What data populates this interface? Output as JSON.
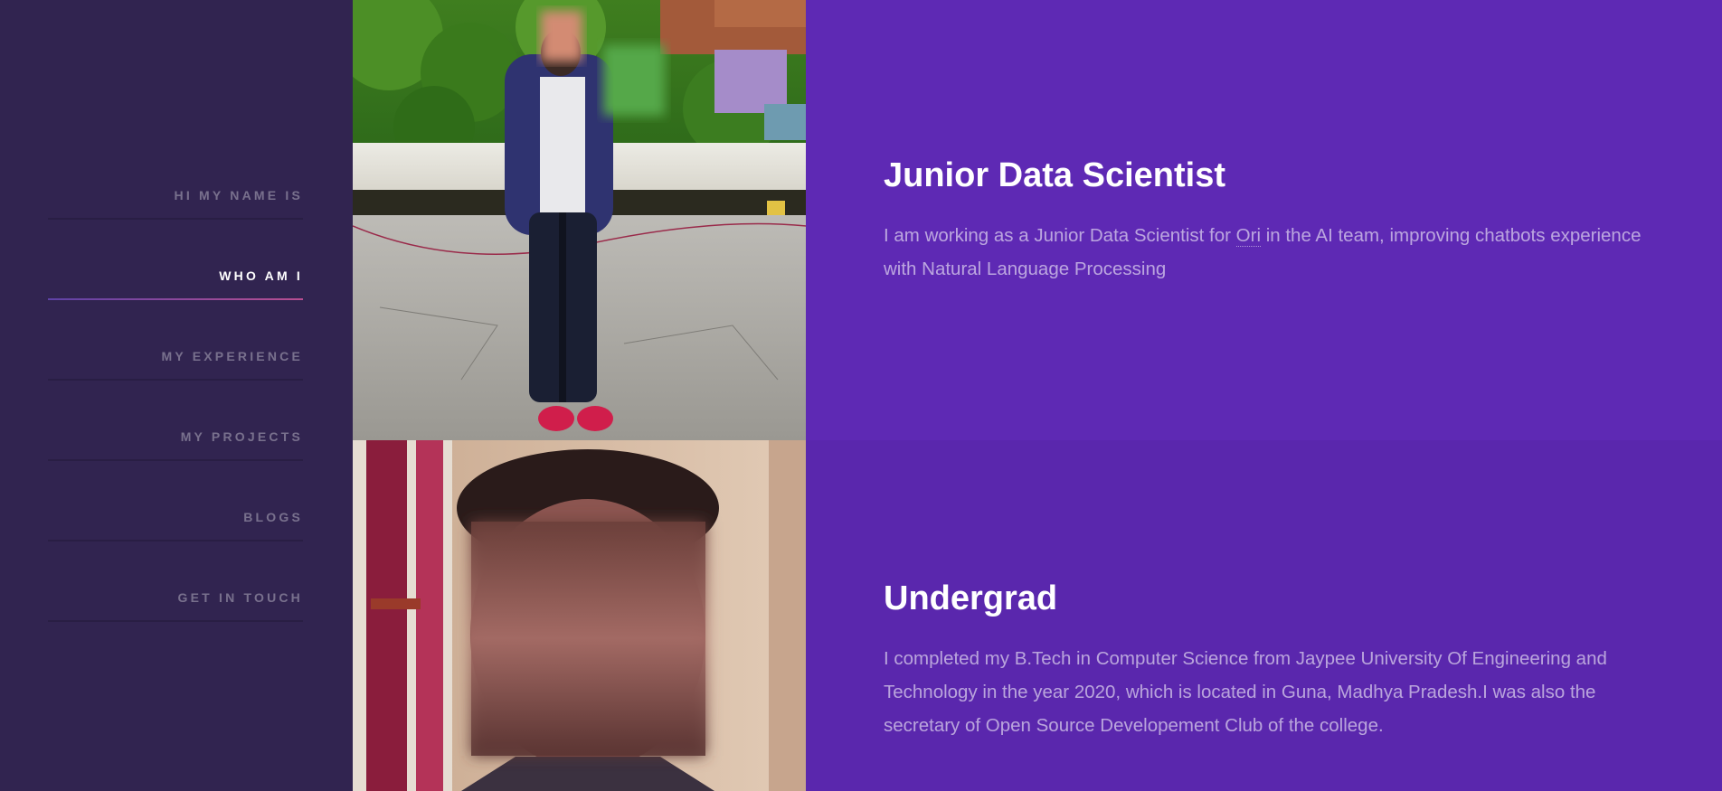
{
  "nav": {
    "items": [
      {
        "label": "HI MY NAME IS",
        "active": false
      },
      {
        "label": "WHO AM I",
        "active": true
      },
      {
        "label": "MY EXPERIENCE",
        "active": false
      },
      {
        "label": "MY PROJECTS",
        "active": false
      },
      {
        "label": "BLOGS",
        "active": false
      },
      {
        "label": "GET IN TOUCH",
        "active": false
      }
    ]
  },
  "sections": [
    {
      "title": "Junior Data Scientist",
      "text_before": "I am working as a Junior Data Scientist for ",
      "link_text": "Ori",
      "text_after": " in the AI team, improving chatbots experience with Natural Language Processing"
    },
    {
      "title": "Undergrad",
      "text": "I completed my B.Tech in Computer Science from Jaypee University Of Engineering and Technology in the year 2020, which is located in Guna, Madhya Pradesh.I was also the secretary of Open Source Developement Club of the college."
    }
  ],
  "colors": {
    "sidebar_bg": "#312450",
    "section1_bg": "#5e29b4",
    "section2_bg": "#5a27ad",
    "accent": "#b74e91"
  }
}
